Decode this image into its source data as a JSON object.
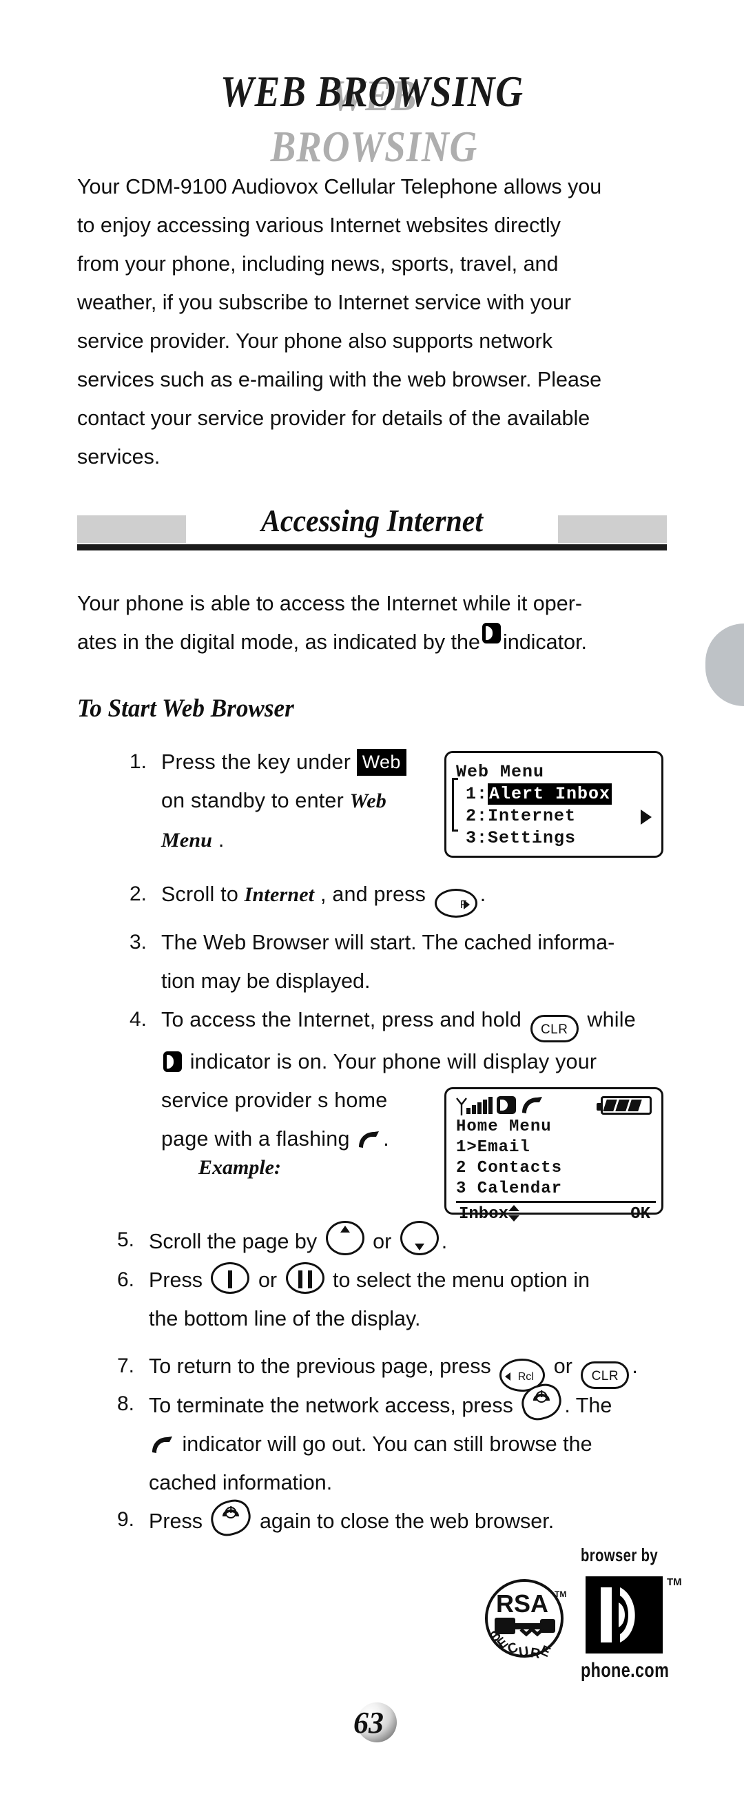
{
  "page": {
    "title": "WEB BROWSING",
    "number": "63"
  },
  "intro": {
    "lines": [
      "Your CDM-9100 Audiovox Cellular Telephone allows you",
      "to enjoy accessing various Internet websites directly",
      "from your phone, including news, sports, travel, and",
      "weather, if you subscribe to Internet service with your",
      "service provider. Your phone also supports network",
      "services such as e-mailing with the web browser. Please",
      "contact your service provider for details of the available",
      "services."
    ]
  },
  "section": {
    "heading": "Accessing Internet",
    "intro_line1": "Your phone is able to access the Internet while it oper-",
    "intro_line2a": "ates in the digital mode, as indicated by the",
    "intro_line2b": "indicator.",
    "subheading": "To Start Web Browser"
  },
  "steps": {
    "s1": {
      "num": "1.",
      "a": "Press the key under",
      "key_label": "Web",
      "b": "on standby to enter",
      "italic1": "Web",
      "italic2": "Menu",
      "period": "."
    },
    "s2": {
      "num": "2.",
      "a": "Scroll to",
      "italic": "Internet",
      "b": ", and press",
      "key_label": "F",
      "period": "."
    },
    "s3": {
      "num": "3.",
      "line1": "The Web Browser will start. The cached informa-",
      "line2": "tion may be displayed."
    },
    "s4": {
      "num": "4.",
      "l1a": "To access the Internet, press and hold",
      "key_clr": "CLR",
      "l1b": "while",
      "l2": "indicator is on. Your phone will display your",
      "l3": "service provider s home",
      "l4a": "page with a flashing",
      "l4b": ".",
      "example": "Example:"
    },
    "s5": {
      "num": "5.",
      "a": "Scroll the page by",
      "b": "or",
      "period": "."
    },
    "s6": {
      "num": "6.",
      "a": "Press",
      "b": "or",
      "c": "to select the menu option in",
      "line2": "the bottom line of the display."
    },
    "s7": {
      "num": "7.",
      "a": "To return to the previous page, press",
      "key_rcl": "Rcl",
      "b": "or",
      "key_clr": "CLR",
      "period": "."
    },
    "s8": {
      "num": "8.",
      "a": "To terminate the network access, press",
      "b": ". The",
      "line2": "indicator will go out. You can still browse the",
      "line3": "cached information."
    },
    "s9": {
      "num": "9.",
      "a": "Press",
      "b": "again to close the web browser."
    }
  },
  "web_menu_display": {
    "title": "Web Menu",
    "rows": [
      {
        "prefix": "1:",
        "label": "Alert Inbox",
        "selected": true
      },
      {
        "prefix": "2:",
        "label": "Internet",
        "selected": false
      },
      {
        "prefix": "3:",
        "label": "Settings",
        "selected": false
      }
    ]
  },
  "home_menu_display": {
    "title": "Home Menu",
    "rows": [
      {
        "text": "1>Email"
      },
      {
        "text": "2 Contacts"
      },
      {
        "text": "3 Calendar"
      }
    ],
    "softkey_left": "Inbox",
    "softkey_right": "OK"
  },
  "logos": {
    "rsa_top": "RSA",
    "rsa_bottom": "SECURE",
    "rsa_tm": "TM",
    "browser_by": "browser by",
    "phone_com": "phone.com",
    "pdc_tm": "TM"
  },
  "colors": {
    "ink": "#101010",
    "gray_bar": "#cfcfcf",
    "title_shadow": "#aeaeae",
    "thumb_tab": "#bec2c6"
  }
}
